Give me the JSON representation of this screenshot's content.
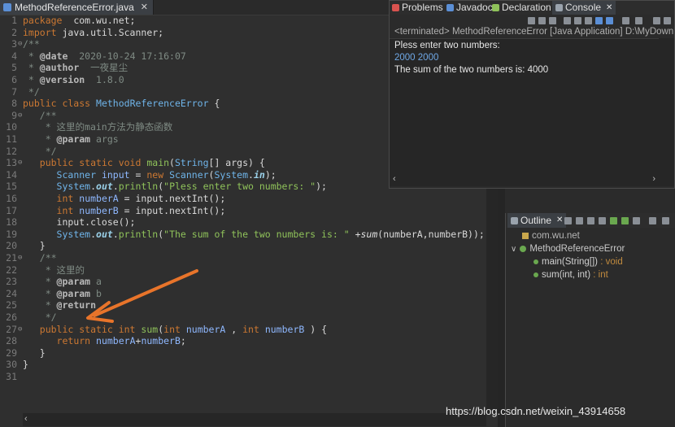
{
  "editor": {
    "tab_label": "MethodReferenceError.java",
    "lines": [
      {
        "n": "1",
        "fold": "",
        "parts": [
          [
            "kw",
            "package"
          ],
          [
            "",
            "  com.wu.net;"
          ]
        ]
      },
      {
        "n": "2",
        "fold": "",
        "parts": [
          [
            "kw",
            "import"
          ],
          [
            "",
            " java.util.Scanner;"
          ]
        ]
      },
      {
        "n": "3",
        "fold": "⊖",
        "parts": [
          [
            "cm",
            "/**"
          ]
        ]
      },
      {
        "n": "4",
        "fold": "",
        "parts": [
          [
            "cm",
            " * "
          ],
          [
            "ann",
            "@date"
          ],
          [
            "cm",
            "  2020-10-24 17:16:07"
          ]
        ]
      },
      {
        "n": "5",
        "fold": "",
        "parts": [
          [
            "cm",
            " * "
          ],
          [
            "ann",
            "@author"
          ],
          [
            "cm",
            "  一夜星尘"
          ]
        ]
      },
      {
        "n": "6",
        "fold": "",
        "parts": [
          [
            "cm",
            " * "
          ],
          [
            "ann",
            "@version"
          ],
          [
            "cm",
            "  1.8.0"
          ]
        ]
      },
      {
        "n": "7",
        "fold": "",
        "parts": [
          [
            "cm",
            " */"
          ]
        ]
      },
      {
        "n": "8",
        "fold": "",
        "parts": [
          [
            "kw",
            "public class"
          ],
          [
            "",
            " "
          ],
          [
            "ty",
            "MethodReferenceError"
          ],
          [
            "",
            " {"
          ]
        ]
      },
      {
        "n": "9",
        "fold": "⊖",
        "parts": [
          [
            "cm",
            "   /**"
          ]
        ]
      },
      {
        "n": "10",
        "fold": "",
        "parts": [
          [
            "cm",
            "    * 这里的main方法为静态函数"
          ]
        ]
      },
      {
        "n": "11",
        "fold": "",
        "parts": [
          [
            "cm",
            "    * "
          ],
          [
            "ann",
            "@param"
          ],
          [
            "cm",
            " args"
          ]
        ]
      },
      {
        "n": "12",
        "fold": "",
        "parts": [
          [
            "cm",
            "    */"
          ]
        ]
      },
      {
        "n": "13",
        "fold": "⊖",
        "parts": [
          [
            "",
            "   "
          ],
          [
            "kw",
            "public static void"
          ],
          [
            "",
            " "
          ],
          [
            "mth",
            "main"
          ],
          [
            "",
            "("
          ],
          [
            "ty",
            "String"
          ],
          [
            "",
            "[] args) {"
          ]
        ]
      },
      {
        "n": "14",
        "fold": "",
        "parts": [
          [
            "",
            "      "
          ],
          [
            "ty",
            "Scanner"
          ],
          [
            "",
            " "
          ],
          [
            "var",
            "input"
          ],
          [
            "",
            " = "
          ],
          [
            "kw",
            "new"
          ],
          [
            "",
            " "
          ],
          [
            "ty",
            "Scanner"
          ],
          [
            "",
            "("
          ],
          [
            "ty",
            "System"
          ],
          [
            "",
            "."
          ],
          [
            "fld",
            "in"
          ],
          [
            "",
            ");"
          ]
        ]
      },
      {
        "n": "15",
        "fold": "",
        "parts": [
          [
            "",
            "      "
          ],
          [
            "ty",
            "System"
          ],
          [
            "",
            "."
          ],
          [
            "fld",
            "out"
          ],
          [
            "",
            "."
          ],
          [
            "mth",
            "println"
          ],
          [
            "",
            "("
          ],
          [
            "str",
            "\"Pless enter two numbers: \""
          ],
          [
            "",
            ");"
          ]
        ]
      },
      {
        "n": "16",
        "fold": "",
        "parts": [
          [
            "",
            "      "
          ],
          [
            "kw",
            "int"
          ],
          [
            "",
            " "
          ],
          [
            "var",
            "numberA"
          ],
          [
            "",
            " = input.nextInt();"
          ]
        ]
      },
      {
        "n": "17",
        "fold": "",
        "parts": [
          [
            "",
            "      "
          ],
          [
            "kw",
            "int"
          ],
          [
            "",
            " "
          ],
          [
            "var",
            "numberB"
          ],
          [
            "",
            " = input.nextInt();"
          ]
        ]
      },
      {
        "n": "18",
        "fold": "",
        "parts": [
          [
            "",
            "      input.close();"
          ]
        ]
      },
      {
        "n": "19",
        "fold": "",
        "parts": [
          [
            "",
            "      "
          ],
          [
            "ty",
            "System"
          ],
          [
            "",
            "."
          ],
          [
            "fld",
            "out"
          ],
          [
            "",
            "."
          ],
          [
            "mth",
            "println"
          ],
          [
            "",
            "("
          ],
          [
            "str",
            "\"The sum of the two numbers is: \""
          ],
          [
            "",
            " +"
          ],
          [
            "sumcall",
            "sum"
          ],
          [
            "",
            "(numberA,numberB));"
          ]
        ]
      },
      {
        "n": "20",
        "fold": "",
        "parts": [
          [
            "",
            "   }"
          ]
        ]
      },
      {
        "n": "21",
        "fold": "⊖",
        "parts": [
          [
            "cm",
            "   /**"
          ]
        ]
      },
      {
        "n": "22",
        "fold": "",
        "parts": [
          [
            "cm",
            "    * 这里的"
          ]
        ]
      },
      {
        "n": "23",
        "fold": "",
        "parts": [
          [
            "cm",
            "    * "
          ],
          [
            "ann",
            "@param"
          ],
          [
            "cm",
            " a"
          ]
        ]
      },
      {
        "n": "24",
        "fold": "",
        "parts": [
          [
            "cm",
            "    * "
          ],
          [
            "ann",
            "@param"
          ],
          [
            "cm",
            " b"
          ]
        ]
      },
      {
        "n": "25",
        "fold": "",
        "parts": [
          [
            "cm",
            "    * "
          ],
          [
            "ann",
            "@return"
          ]
        ]
      },
      {
        "n": "26",
        "fold": "",
        "parts": [
          [
            "cm",
            "    */"
          ]
        ]
      },
      {
        "n": "27",
        "fold": "⊖",
        "parts": [
          [
            "",
            "   "
          ],
          [
            "kw",
            "public static int"
          ],
          [
            "",
            " "
          ],
          [
            "mth",
            "sum"
          ],
          [
            "",
            "("
          ],
          [
            "kw",
            "int"
          ],
          [
            "",
            " "
          ],
          [
            "var",
            "numberA"
          ],
          [
            "",
            " , "
          ],
          [
            "kw",
            "int"
          ],
          [
            "",
            " "
          ],
          [
            "var",
            "numberB"
          ],
          [
            "",
            " ) {"
          ]
        ]
      },
      {
        "n": "28",
        "fold": "",
        "parts": [
          [
            "",
            "      "
          ],
          [
            "kw",
            "return"
          ],
          [
            "",
            " "
          ],
          [
            "var",
            "numberA"
          ],
          [
            "",
            "+"
          ],
          [
            "var",
            "numberB"
          ],
          [
            "",
            ";"
          ]
        ]
      },
      {
        "n": "29",
        "fold": "",
        "parts": [
          [
            "",
            "   }"
          ]
        ]
      },
      {
        "n": "30",
        "fold": "",
        "parts": [
          [
            "",
            "}"
          ]
        ]
      },
      {
        "n": "31",
        "fold": "",
        "parts": [
          [
            "",
            ""
          ]
        ]
      }
    ]
  },
  "console_panel": {
    "tabs": [
      {
        "label": "Problems",
        "icon_color": "#d9534f"
      },
      {
        "label": "Javadoc",
        "icon_color": "#5b8fd6"
      },
      {
        "label": "Declaration",
        "icon_color": "#8fc25a"
      },
      {
        "label": "Console",
        "icon_color": "#9aa3ad"
      }
    ],
    "close_glyph": "✕",
    "status": "<terminated> MethodReferenceError [Java Application] D:\\MyDown",
    "output": [
      {
        "text": "Pless enter two numbers:",
        "kind": "out"
      },
      {
        "text": "2000 2000",
        "kind": "input"
      },
      {
        "text": "The sum of the two numbers is: 4000",
        "kind": "out"
      }
    ]
  },
  "outline_panel": {
    "tab_label": "Outline",
    "close_glyph": "✕",
    "items": [
      {
        "label": "com.wu.net",
        "sig": "",
        "kind": "package",
        "icon": "package-icon"
      },
      {
        "label": "MethodReferenceError",
        "sig": "",
        "kind": "class",
        "icon": "class-icon"
      },
      {
        "label": "main(String[])",
        "sig": " : void",
        "kind": "method",
        "icon": "method-icon"
      },
      {
        "label": "sum(int, int)",
        "sig": " : int",
        "kind": "method",
        "icon": "method-icon"
      }
    ]
  },
  "watermark": "https://blog.csdn.net/weixin_43914658",
  "colors": {
    "accent_arrow": "#e8742a",
    "keyword": "#cc7832",
    "type": "#6fb4e9",
    "string": "#8fc25a"
  }
}
